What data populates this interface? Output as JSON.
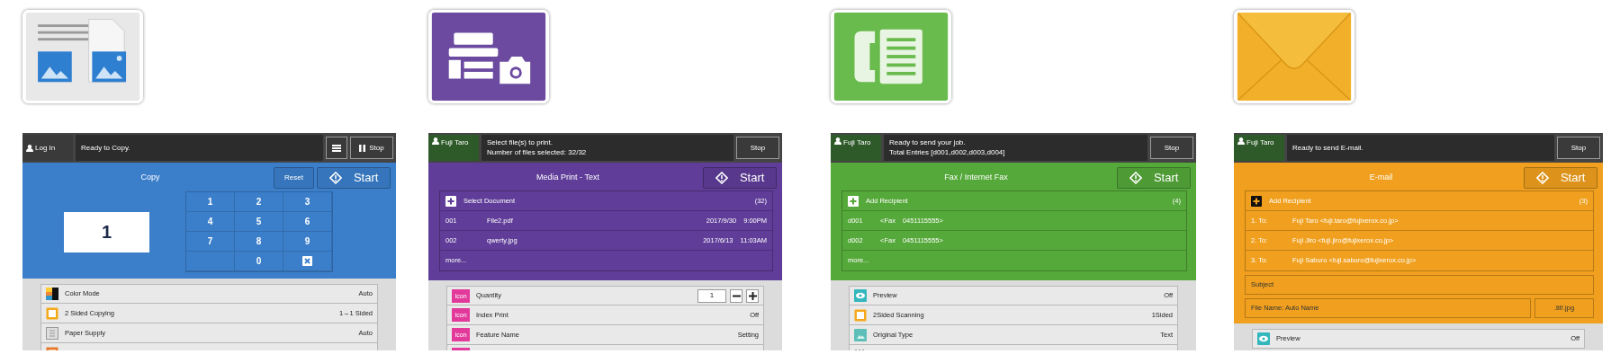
{
  "apps": [
    {
      "kind": "copy",
      "color": "#3b7fcb",
      "header": {
        "user": "Log In",
        "signed_in": false,
        "status": [
          "Ready to Copy."
        ],
        "menu_button": true,
        "stop": "Stop",
        "stop_icon": true
      },
      "title": "Copy",
      "reset": "Reset",
      "start": "Start",
      "quantity": "1",
      "keys": [
        "1",
        "2",
        "3",
        "4",
        "5",
        "6",
        "7",
        "8",
        "9",
        "0"
      ],
      "settings": [
        {
          "kind": "color-mode",
          "label": "Color Mode",
          "value": "Auto"
        },
        {
          "kind": "two-sided",
          "label": "2 Sided Copying",
          "value": "1→1 Sided"
        },
        {
          "kind": "paper",
          "label": "Paper Supply",
          "value": "Auto"
        },
        {
          "kind": "reduce"
        }
      ]
    },
    {
      "kind": "media-print",
      "color": "#5f3d98",
      "header": {
        "user": "Fuji Taro",
        "signed_in": true,
        "status": [
          "Select file(s) to print.",
          "Number of files selected: 32/32"
        ],
        "menu_button": false,
        "stop": "Stop",
        "stop_icon": false
      },
      "title": "Media Print - Text",
      "start": "Start",
      "blocks": [
        {
          "kind": "list",
          "rows": [
            {
              "kind": "add",
              "label": "Select Document",
              "count": "(32)"
            },
            {
              "kind": "entry",
              "cells": [
                "001",
                "File2.pdf"
              ],
              "meta": [
                "2017/9/30",
                "9:00PM"
              ]
            },
            {
              "kind": "entry",
              "cells": [
                "002",
                "qwerty.jpg"
              ],
              "meta": [
                "2017/6/13",
                "11:03AM"
              ]
            },
            {
              "kind": "more",
              "label": "more..."
            }
          ]
        }
      ],
      "settings": [
        {
          "kind": "placeholder",
          "icon_text": "Icon",
          "label": "Quantity",
          "counter": "1"
        },
        {
          "kind": "placeholder",
          "icon_text": "Icon",
          "label": "Index Print",
          "value": "Off"
        },
        {
          "kind": "placeholder",
          "icon_text": "Icon",
          "label": "Feature Name",
          "value": "Setting"
        },
        {
          "kind": "placeholder"
        }
      ]
    },
    {
      "kind": "fax",
      "color": "#55a83a",
      "header": {
        "user": "Fuji Taro",
        "signed_in": true,
        "status": [
          "Ready to send your job.",
          "Total Entries [d001,d002,d003,d004]"
        ],
        "menu_button": false,
        "stop": "Stop",
        "stop_icon": false
      },
      "title": "Fax / Internet Fax",
      "start": "Start",
      "blocks": [
        {
          "kind": "list",
          "rows": [
            {
              "kind": "add",
              "label": "Add Recipient",
              "count": "(4)"
            },
            {
              "kind": "entry",
              "cells": [
                "d001",
                "<Fax",
                "0451115555>"
              ]
            },
            {
              "kind": "entry",
              "cells": [
                "d002",
                "<Fax",
                "0451115555>"
              ]
            },
            {
              "kind": "more",
              "label": "more..."
            }
          ]
        }
      ],
      "settings": [
        {
          "kind": "preview",
          "label": "Preview",
          "value": "Off"
        },
        {
          "kind": "two-sided",
          "label": "2Sided Scanning",
          "value": "1Sided"
        },
        {
          "kind": "original-type",
          "label": "Original Type",
          "value": "Text"
        },
        {
          "kind": "resolution"
        }
      ]
    },
    {
      "kind": "email",
      "color": "#f0a01e",
      "header": {
        "user": "Fuji Taro",
        "signed_in": true,
        "status": [
          "Ready to send E-mail."
        ],
        "menu_button": false,
        "stop": "Stop",
        "stop_icon": false
      },
      "title": "E-mail",
      "start": "Start",
      "blocks": [
        {
          "kind": "list",
          "rows": [
            {
              "kind": "add",
              "label": "Add Recipient",
              "count": "(3)"
            },
            {
              "kind": "entry",
              "cells": [
                "1. To:",
                "Fuji Taro <fuji.taro@fujixerox.co.jp>"
              ]
            },
            {
              "kind": "entry",
              "cells": [
                "2. To:",
                "Fuji Jiro <fuji.jiro@fujixerox.co.jp>"
              ]
            },
            {
              "kind": "entry",
              "cells": [
                "3. To:",
                "Fuji Saburo <fuji.saburo@fujixerox.co.jp>"
              ]
            }
          ]
        },
        {
          "kind": "field",
          "label": "Subject"
        },
        {
          "kind": "field-pair",
          "label": "File Name: Auto Name",
          "extra": ".tif/.jpg"
        }
      ],
      "settings": [
        {
          "kind": "preview",
          "label": "Preview",
          "value": "Off"
        }
      ]
    }
  ]
}
